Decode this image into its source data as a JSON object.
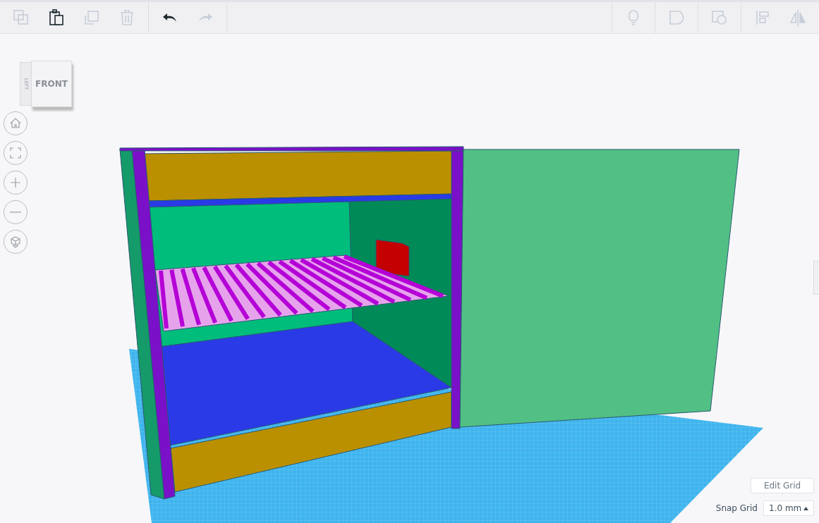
{
  "toolbar": {
    "left_groups": [
      [
        {
          "kind": "copy",
          "disabled": true
        },
        {
          "kind": "paste",
          "disabled": false
        },
        {
          "kind": "duplicate",
          "disabled": true
        },
        {
          "kind": "delete",
          "disabled": true
        }
      ],
      [
        {
          "kind": "undo",
          "disabled": false
        },
        {
          "kind": "redo",
          "disabled": true
        }
      ]
    ],
    "right_groups": [
      [
        {
          "kind": "hint",
          "disabled": true
        }
      ],
      [
        {
          "kind": "group",
          "disabled": true
        }
      ],
      [
        {
          "kind": "ungroup",
          "disabled": true
        }
      ],
      [
        {
          "kind": "align",
          "disabled": true
        },
        {
          "kind": "mirror",
          "disabled": true
        }
      ]
    ]
  },
  "view_cube": {
    "front": "FRONT",
    "left": "LEFT"
  },
  "nav_buttons": [
    {
      "kind": "home"
    },
    {
      "kind": "fit"
    },
    {
      "kind": "zoom_in"
    },
    {
      "kind": "zoom_out"
    },
    {
      "kind": "ortho"
    }
  ],
  "grid_controls": {
    "edit_button": "Edit Grid",
    "snap_label": "Snap Grid",
    "snap_value": "1.0 mm"
  }
}
